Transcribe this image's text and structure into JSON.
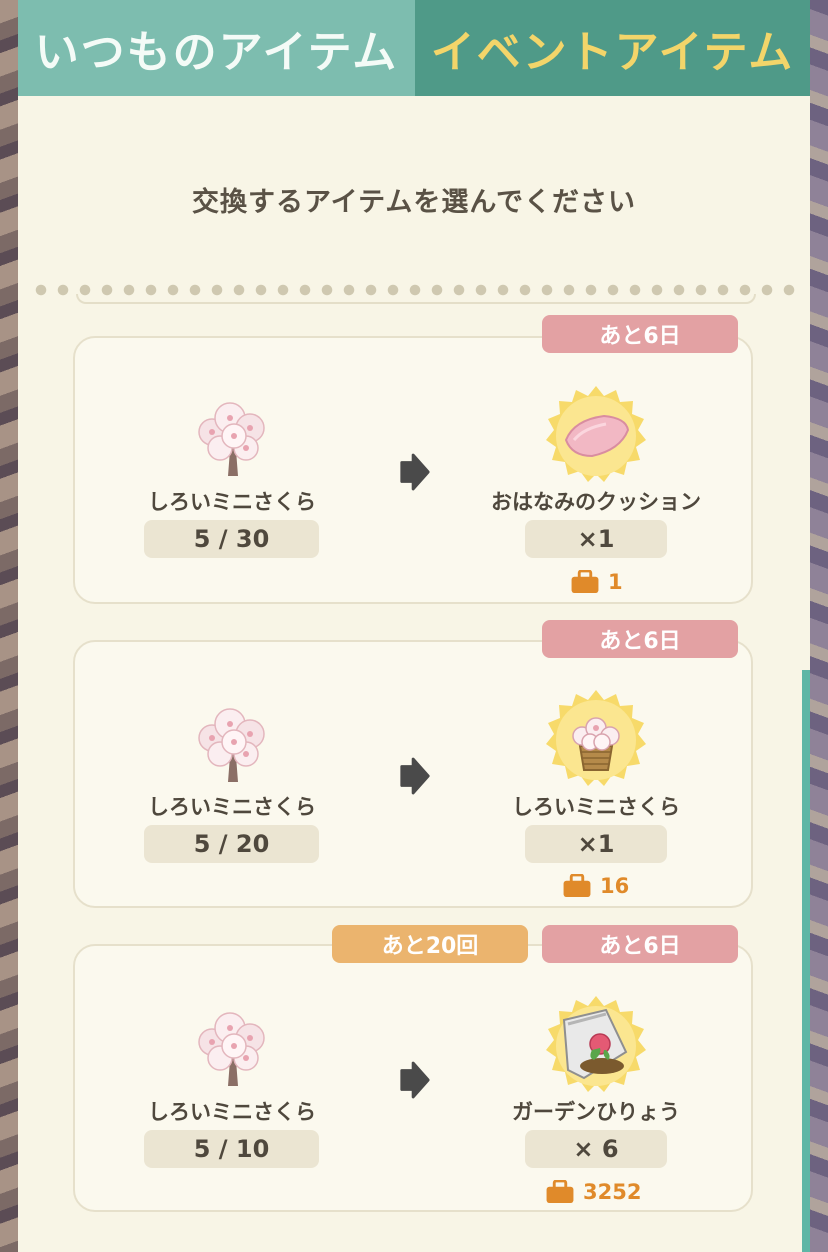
{
  "tabs": {
    "normal": "いつものアイテム",
    "event": "イベントアイテム"
  },
  "instruction": "交換するアイテムを選んでください",
  "colors": {
    "tab_normal": "#7dbdaf",
    "tab_event": "#4f9a88",
    "event_text": "#f3d56a",
    "days_tag": "#e3a1a3",
    "count_tag": "#ebb46e",
    "bag": "#e08a2a"
  },
  "offers": [
    {
      "days_left": "あと6日",
      "count_left": "",
      "cost_item_icon": "cherry-tree-icon",
      "cost_name": "しろいミニさくら",
      "cost_progress": "5 / 30",
      "reward_icon": "pink-cushion-icon",
      "reward_name": "おはなみのクッション",
      "reward_qty": "×1",
      "owned": "1"
    },
    {
      "days_left": "あと6日",
      "count_left": "",
      "cost_item_icon": "cherry-tree-icon",
      "cost_name": "しろいミニさくら",
      "cost_progress": "5 / 20",
      "reward_icon": "potted-cherry-icon",
      "reward_name": "しろいミニさくら",
      "reward_qty": "×1",
      "owned": "16"
    },
    {
      "days_left": "あと6日",
      "count_left": "あと20回",
      "cost_item_icon": "cherry-tree-icon",
      "cost_name": "しろいミニさくら",
      "cost_progress": "5 / 10",
      "reward_icon": "fertilizer-bag-icon",
      "reward_name": "ガーデンひりょう",
      "reward_qty": "× 6",
      "owned": "3252"
    }
  ]
}
